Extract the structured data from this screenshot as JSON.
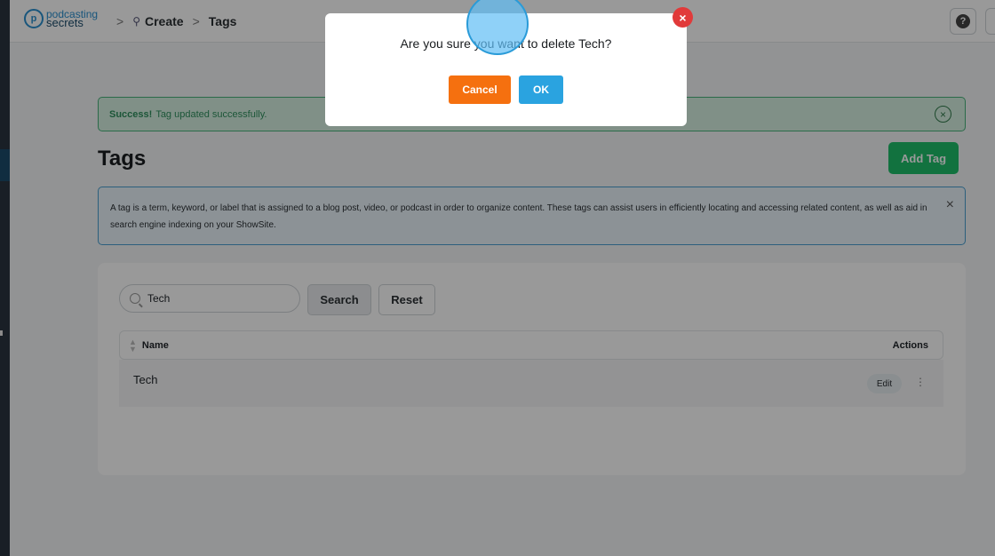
{
  "topbar": {
    "logo": {
      "line1": "podcasting",
      "line2": "secrets",
      "mark": "p"
    },
    "breadcrumb": {
      "items": [
        "Create",
        "Tags"
      ],
      "separator": ">"
    },
    "help": "?"
  },
  "alert": {
    "strong": "Success!",
    "text": "Tag updated successfully.",
    "close": "×"
  },
  "page": {
    "title": "Tags",
    "add_button": "Add Tag"
  },
  "info": {
    "text": "A tag is a term, keyword, or label that is assigned to a blog post, video, or podcast in order to organize content. These tags can assist users in efficiently locating and accessing related content, as well as aid in search engine indexing on your ShowSite.",
    "close": "×"
  },
  "filters": {
    "search_value": "Tech",
    "search_button": "Search",
    "reset_button": "Reset"
  },
  "table": {
    "columns": [
      "Name",
      "Actions"
    ],
    "rows": [
      {
        "name": "Tech",
        "edit": "Edit",
        "more": "⋮"
      }
    ]
  },
  "modal": {
    "message": "Are you sure you want to delete Tech?",
    "cancel": "Cancel",
    "ok": "OK",
    "close": "×"
  },
  "colors": {
    "success": "#1fbf6a",
    "cancel": "#f5700f",
    "ok": "#2aa3e0",
    "danger": "#e13a3a",
    "brand": "#2a8fcf"
  }
}
